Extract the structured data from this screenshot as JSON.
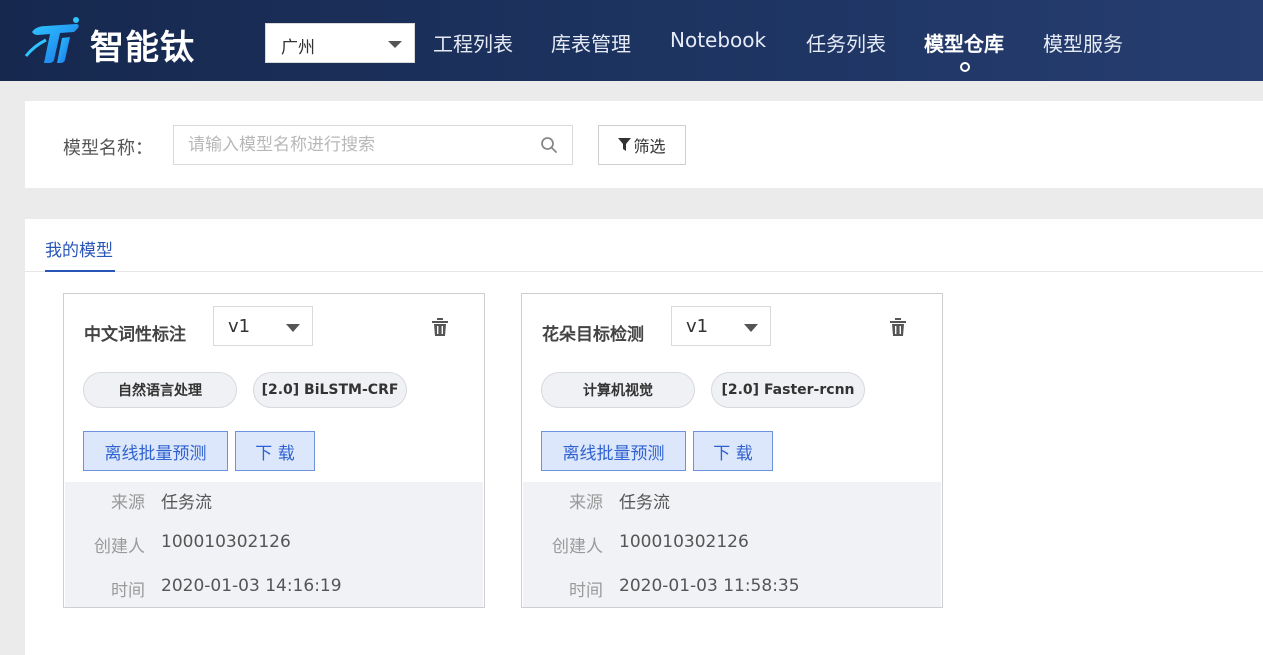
{
  "header": {
    "brand": "智能钛",
    "region": {
      "selected": "广州"
    },
    "nav": [
      {
        "label": "工程列表",
        "active": false
      },
      {
        "label": "库表管理",
        "active": false
      },
      {
        "label": "Notebook",
        "active": false
      },
      {
        "label": "任务列表",
        "active": false
      },
      {
        "label": "模型仓库",
        "active": true
      },
      {
        "label": "模型服务",
        "active": false
      }
    ]
  },
  "search": {
    "label": "模型名称：",
    "placeholder": "请输入模型名称进行搜索",
    "value": "",
    "filter_label": "筛选"
  },
  "tabs": [
    {
      "label": "我的模型",
      "active": true
    }
  ],
  "models": [
    {
      "name": "中文词性标注",
      "version": "v1",
      "tags": [
        "自然语言处理",
        "[2.0] BiLSTM-CRF"
      ],
      "actions": {
        "predict": "离线批量预测",
        "download": "下 载"
      },
      "meta": [
        {
          "key": "来源",
          "value": "任务流"
        },
        {
          "key": "创建人",
          "value": "100010302126"
        },
        {
          "key": "时间",
          "value": "2020-01-03 14:16:19"
        }
      ]
    },
    {
      "name": "花朵目标检测",
      "version": "v1",
      "tags": [
        "计算机视觉",
        "[2.0] Faster-rcnn"
      ],
      "actions": {
        "predict": "离线批量预测",
        "download": "下 载"
      },
      "meta": [
        {
          "key": "来源",
          "value": "任务流"
        },
        {
          "key": "创建人",
          "value": "100010302126"
        },
        {
          "key": "时间",
          "value": "2020-01-03 11:58:35"
        }
      ]
    }
  ],
  "colors": {
    "nav_bg": "#1b2f5a",
    "accent": "#2a56b8",
    "button_bg": "#dce7fb",
    "meta_bg": "#f1f2f5"
  },
  "icons": [
    "logo-icon",
    "caret-down-icon",
    "search-icon",
    "filter-icon",
    "trash-icon"
  ]
}
